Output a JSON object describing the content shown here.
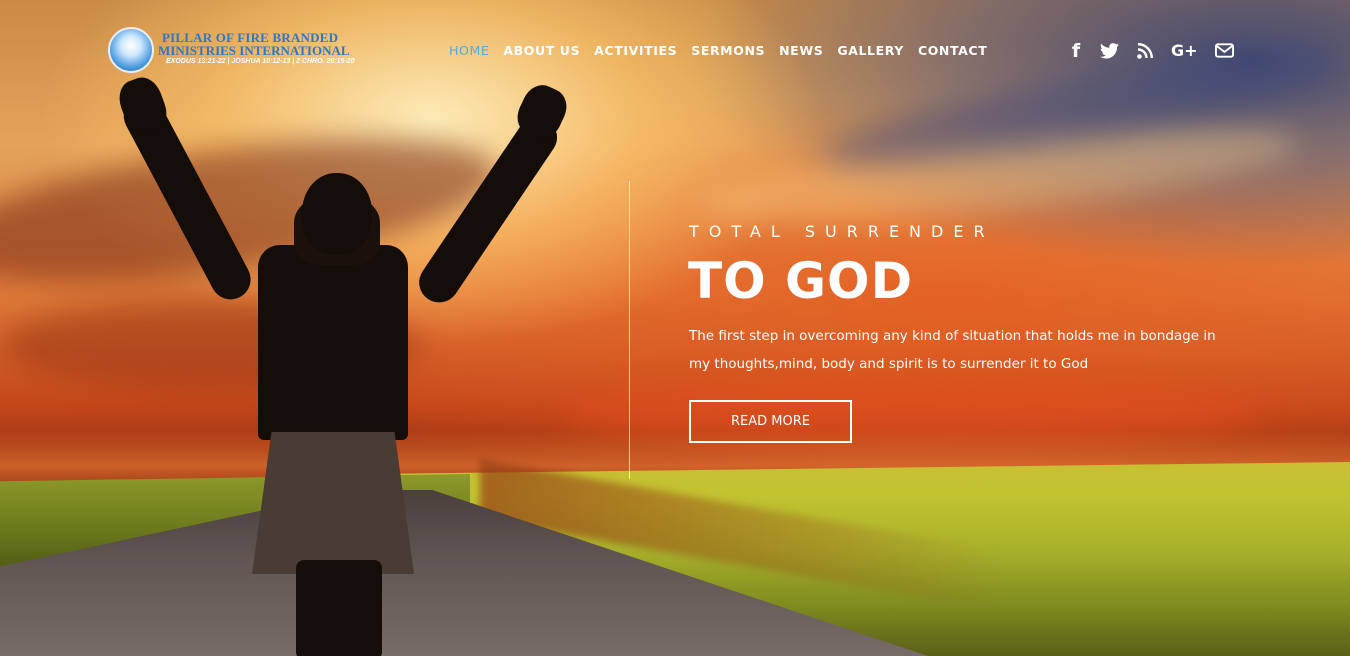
{
  "logo": {
    "line1": "PILLAR OF FIRE BRANDED",
    "line2": "MINISTRIES INTERNATIONAL",
    "line3": "EXODUS 13:21-22 | JOSHUA 10:12-13 | 2 CHRO. 20:15-20"
  },
  "nav": {
    "items": [
      {
        "label": "HOME",
        "active": true
      },
      {
        "label": "ABOUT US"
      },
      {
        "label": "ACTIVITIES"
      },
      {
        "label": "SERMONS"
      },
      {
        "label": "NEWS"
      },
      {
        "label": "GALLERY"
      },
      {
        "label": "CONTACT"
      }
    ],
    "active_color": "#5aa9d8"
  },
  "social": {
    "icons": [
      "facebook-icon",
      "twitter-icon",
      "rss-icon",
      "google-plus-icon",
      "mail-icon"
    ],
    "facebook_glyph": "f",
    "googleplus_glyph": "G+"
  },
  "hero": {
    "kicker": "TOTAL SURRENDER",
    "headline": "TO GOD",
    "description": "The first step in overcoming any kind of situation that holds me in bondage in my thoughts,mind, body and spirit is to surrender it to God",
    "button_label": "READ MORE"
  }
}
